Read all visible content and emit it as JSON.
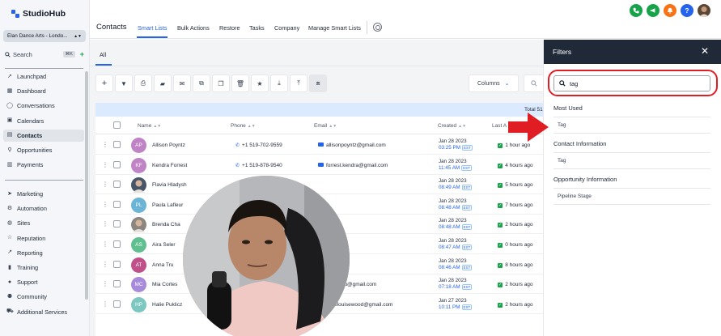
{
  "app": {
    "name": "StudioHub",
    "brand_color": "#2563eb"
  },
  "sidebar": {
    "location": "Elan Dance Arts - Londo...",
    "search_label": "Search",
    "search_shortcut": "⌘K",
    "items_top": [
      {
        "label": "Launchpad",
        "icon": "rocket-icon"
      },
      {
        "label": "Dashboard",
        "icon": "dashboard-icon"
      },
      {
        "label": "Conversations",
        "icon": "chat-icon"
      },
      {
        "label": "Calendars",
        "icon": "calendar-icon"
      },
      {
        "label": "Contacts",
        "icon": "contacts-icon",
        "active": true
      },
      {
        "label": "Opportunities",
        "icon": "funnel-icon"
      },
      {
        "label": "Payments",
        "icon": "payments-icon"
      }
    ],
    "items_bottom": [
      {
        "label": "Marketing",
        "icon": "send-icon"
      },
      {
        "label": "Automation",
        "icon": "automation-icon"
      },
      {
        "label": "Sites",
        "icon": "globe-icon"
      },
      {
        "label": "Reputation",
        "icon": "star-icon"
      },
      {
        "label": "Reporting",
        "icon": "chart-icon"
      },
      {
        "label": "Training",
        "icon": "book-icon"
      },
      {
        "label": "Support",
        "icon": "support-icon"
      },
      {
        "label": "Community",
        "icon": "people-icon"
      },
      {
        "label": "Additional Services",
        "icon": "cart-icon"
      }
    ]
  },
  "header": {
    "title": "Contacts",
    "tabs": [
      "Smart Lists",
      "Bulk Actions",
      "Restore",
      "Tasks",
      "Company",
      "Manage Smart Lists"
    ],
    "active_tab": "Smart Lists",
    "buttons": [
      {
        "icon": "phone-icon",
        "color": "#16a34a"
      },
      {
        "icon": "megaphone-icon",
        "color": "#16a34a"
      },
      {
        "icon": "bell-icon",
        "color": "#f97316"
      },
      {
        "icon": "help-icon",
        "color": "#2563eb",
        "text": "?"
      }
    ]
  },
  "subtabs": {
    "all_label": "All"
  },
  "toolbar": {
    "icons": [
      "add-icon",
      "filter-icon",
      "print-icon",
      "message-icon",
      "email-icon",
      "copy-icon",
      "paste-icon",
      "delete-icon",
      "star-icon",
      "import-icon",
      "export-icon",
      "merge-icon"
    ],
    "columns_label": "Columns"
  },
  "table": {
    "total_label": "Total 51",
    "headers": {
      "name": "Name",
      "phone": "Phone",
      "email": "Email",
      "created": "Created",
      "last": "Last A"
    },
    "rows": [
      {
        "initials": "AP",
        "name": "Allison Poyntz",
        "phone": "+1 519-702-9559",
        "email": "allisonpoyntz@gmail.com",
        "date": "Jan 28 2023",
        "time": "03:25 PM",
        "last": "1 hour ago",
        "color": "#c084c6",
        "photo": false
      },
      {
        "initials": "KF",
        "name": "Kendra Forrest",
        "phone": "+1 519-878-9540",
        "email": "forrest.kendra@gmail.com",
        "date": "Jan 28 2023",
        "time": "11:45 AM",
        "last": "4 hours ago",
        "color": "#c084c6",
        "photo": false
      },
      {
        "initials": "",
        "name": "Flavia Hladysh",
        "phone": "",
        "email": "",
        "date": "Jan 28 2023",
        "time": "08:49 AM",
        "last": "5 hours ago",
        "color": "#475569",
        "photo": true
      },
      {
        "initials": "PL",
        "name": "Paula Lafleur",
        "phone": "",
        "email": "",
        "date": "Jan 28 2023",
        "time": "08:48 AM",
        "last": "7 hours ago",
        "color": "#6bb4d6",
        "photo": false
      },
      {
        "initials": "",
        "name": "Brenda Cha",
        "phone": "",
        "email": "",
        "date": "Jan 28 2023",
        "time": "08:48 AM",
        "last": "2 hours ago",
        "color": "#8b8680",
        "photo": true
      },
      {
        "initials": "AS",
        "name": "Aira Seler",
        "phone": "",
        "email": "",
        "date": "Jan 28 2023",
        "time": "08:47 AM",
        "last": "0 hours ago",
        "color": "#5fbf8f",
        "photo": false
      },
      {
        "initials": "AT",
        "name": "Anna Tru",
        "phone": "",
        "email": "",
        "date": "Jan 28 2023",
        "time": "08:46 AM",
        "last": "8 hours ago",
        "color": "#c0508a",
        "photo": false
      },
      {
        "initials": "MC",
        "name": "Mia Cortes",
        "phone": "",
        "email": "ckalbuuu@gmail.com",
        "date": "Jan 28 2023",
        "time": "07:18 AM",
        "last": "2 hours ago",
        "color": "#a78bda",
        "photo": false
      },
      {
        "initials": "HP",
        "name": "Halie Puklicz",
        "phone": "",
        "email": "halielouisewood@gmail.com",
        "date": "Jan 27 2023",
        "time": "10:11 PM",
        "last": "2 hours ago",
        "color": "#7cc7c0",
        "photo": false
      }
    ],
    "tz": "EST"
  },
  "filters": {
    "title": "Filters",
    "search_value": "tag",
    "sections": [
      {
        "title": "Most Used",
        "items": [
          "Tag"
        ]
      },
      {
        "title": "Contact Information",
        "items": [
          "Tag"
        ]
      },
      {
        "title": "Opportunity Information",
        "items": [
          "Pipeline Stage"
        ]
      }
    ]
  }
}
